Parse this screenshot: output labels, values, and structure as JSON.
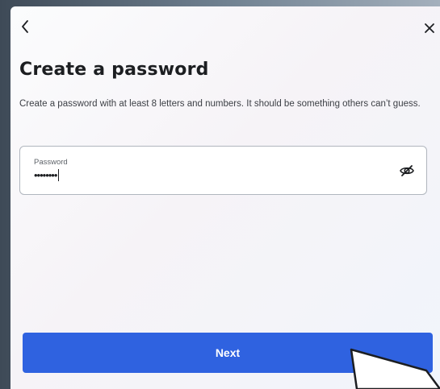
{
  "dialog": {
    "back_icon": "chevron-left-icon",
    "close_icon": "close-icon",
    "title": "Create a password",
    "description": "Create a password with at least 8 letters and numbers. It should be something others can’t guess."
  },
  "password_field": {
    "label": "Password",
    "value": "••••••••",
    "toggle_icon": "eye-slash-icon"
  },
  "next_button": {
    "label": "Next"
  },
  "colors": {
    "primary": "#2f62e0",
    "title_text": "#1c1e21",
    "body_text": "#3d4046",
    "field_border": "#b0b6be"
  }
}
